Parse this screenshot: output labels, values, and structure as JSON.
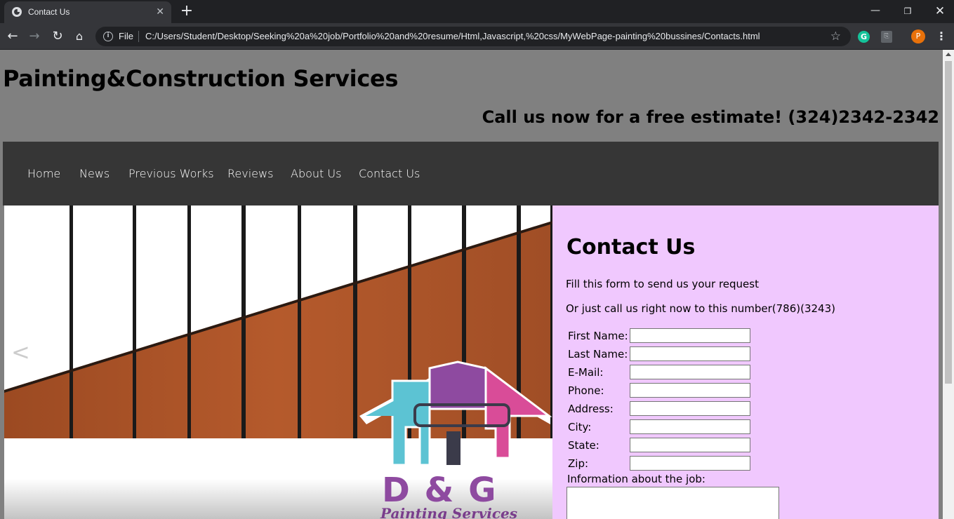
{
  "browser": {
    "tab_title": "Contact Us",
    "tab_close": "✕",
    "new_tab": "+",
    "scheme_label": "File",
    "url": "C:/Users/Student/Desktop/Seeking%20a%20job/Portfolio%20and%20resume/Html,Javascript,%20css/MyWebPage-painting%20bussines/Contacts.html",
    "profile_initial": "P",
    "icons": [
      "back-icon",
      "forward-icon",
      "reload-icon",
      "home-icon",
      "info-icon",
      "star-icon",
      "grammarly-icon",
      "pdf-icon",
      "profile-avatar",
      "menu-icon",
      "minimize-icon",
      "maximize-icon",
      "close-icon"
    ]
  },
  "header": {
    "site_title": "Painting&Construction Services",
    "call_banner": "Call us now for a free estimate! (324)2342-2342"
  },
  "nav": {
    "items": [
      {
        "label": "Home"
      },
      {
        "label": "News"
      },
      {
        "label": "Previous Works"
      },
      {
        "label": "Reviews"
      },
      {
        "label": "About Us"
      },
      {
        "label": "Contact Us"
      }
    ]
  },
  "slider": {
    "prev_label": "<",
    "logo_text": "D & G",
    "logo_subtext": "Painting Services"
  },
  "contact": {
    "heading": "Contact Us",
    "intro": "Fill this form to send us your request",
    "call_text": "Or just call us right now to this number(786)(3243)",
    "fields": [
      {
        "label": "First Name:",
        "value": ""
      },
      {
        "label": "Last Name:",
        "value": ""
      },
      {
        "label": "E-Mail:",
        "value": ""
      },
      {
        "label": "Phone:",
        "value": ""
      },
      {
        "label": "Address:",
        "value": ""
      },
      {
        "label": "City:",
        "value": ""
      },
      {
        "label": "State:",
        "value": ""
      },
      {
        "label": "Zip:",
        "value": ""
      }
    ],
    "info_label": "Information about the job:"
  },
  "colors": {
    "page_bg": "#808080",
    "nav_bg": "#363636",
    "contact_bg": "#f0c8fe",
    "logo_teal": "#5cc3d3",
    "logo_purple": "#8e4aa0",
    "logo_pink": "#d94c98"
  }
}
